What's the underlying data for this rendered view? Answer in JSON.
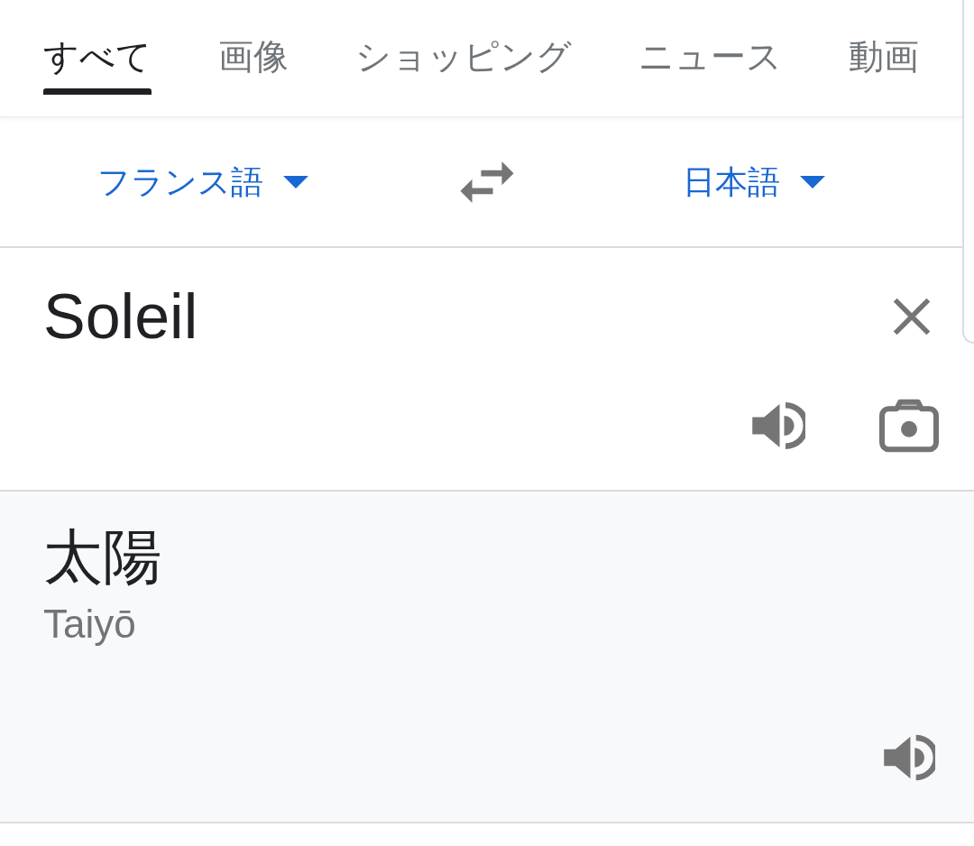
{
  "tabs": [
    {
      "label": "すべて",
      "selected": true
    },
    {
      "label": "画像",
      "selected": false
    },
    {
      "label": "ショッピング",
      "selected": false
    },
    {
      "label": "ニュース",
      "selected": false
    },
    {
      "label": "動画",
      "selected": false
    }
  ],
  "language_bar": {
    "source_language": "フランス語",
    "target_language": "日本語"
  },
  "source": {
    "value": "Soleil"
  },
  "translation": {
    "text": "太陽",
    "romanization": "Taiyō"
  }
}
